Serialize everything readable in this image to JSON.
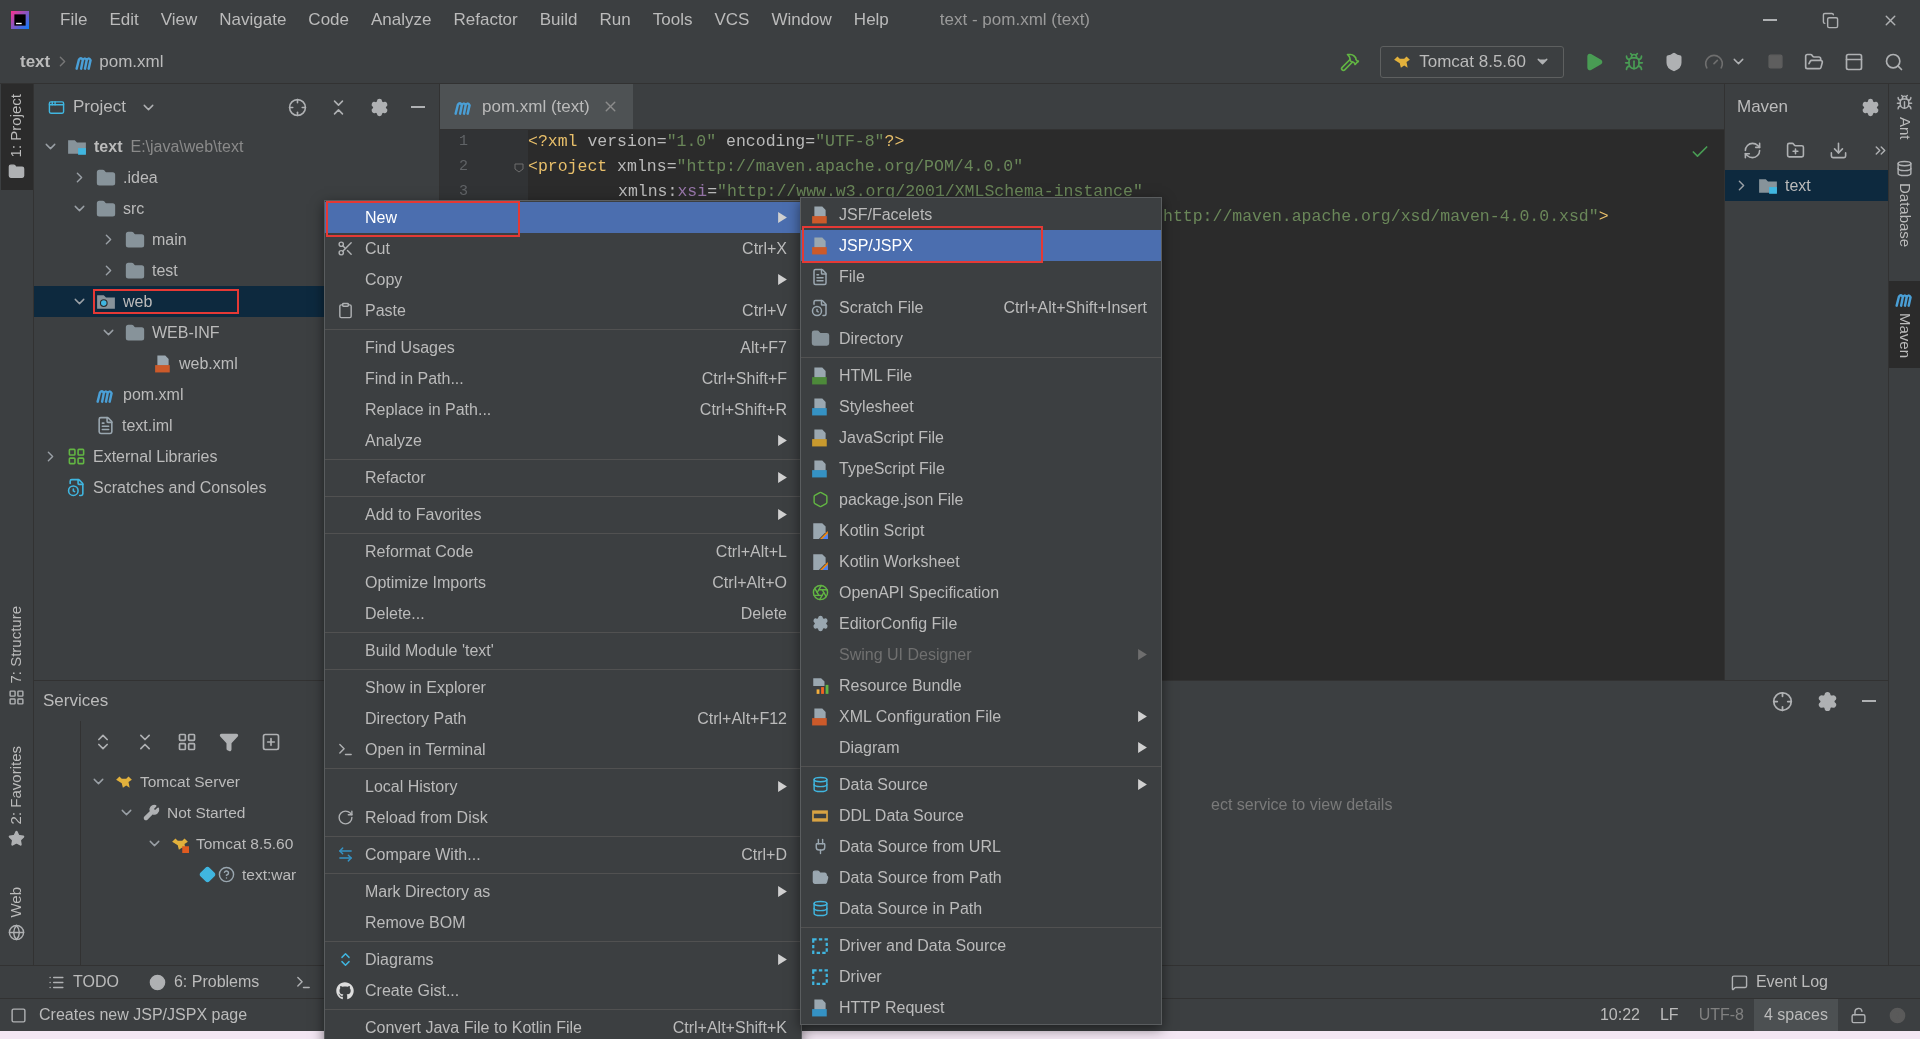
{
  "title_bar": {
    "menus": [
      "File",
      "Edit",
      "View",
      "Navigate",
      "Code",
      "Analyze",
      "Refactor",
      "Build",
      "Run",
      "Tools",
      "VCS",
      "Window",
      "Help"
    ],
    "title": "text - pom.xml (text)"
  },
  "nav_bar": {
    "breadcrumbs": [
      "text",
      "pom.xml"
    ],
    "run_config": "Tomcat 8.5.60"
  },
  "left_stripe": [
    {
      "label": "1: Project",
      "selected": true
    },
    {
      "label": "7: Structure",
      "selected": false
    },
    {
      "label": "2: Favorites",
      "selected": false
    },
    {
      "label": "Web",
      "selected": false
    }
  ],
  "right_stripe": [
    {
      "label": "Ant",
      "selected": false
    },
    {
      "label": "Database",
      "selected": false
    },
    {
      "label": "Maven",
      "selected": true
    }
  ],
  "project": {
    "title": "Project",
    "tree": [
      {
        "label": "text",
        "detail": "E:\\java\\web\\text",
        "kind": "module",
        "expanded": true,
        "selected": false,
        "outlined": false,
        "children": [
          {
            "label": ".idea",
            "kind": "folder",
            "expanded": false,
            "selected": false,
            "outlined": false
          },
          {
            "label": "src",
            "kind": "folder",
            "expanded": true,
            "selected": false,
            "outlined": false,
            "children": [
              {
                "label": "main",
                "kind": "folder",
                "expanded": false,
                "selected": false,
                "outlined": false
              },
              {
                "label": "test",
                "kind": "folder",
                "expanded": false,
                "selected": false,
                "outlined": false
              }
            ]
          },
          {
            "label": "web",
            "kind": "web",
            "expanded": true,
            "selected": true,
            "outlined": true,
            "children": [
              {
                "label": "WEB-INF",
                "kind": "folder",
                "expanded": true,
                "selected": false,
                "outlined": false,
                "children": [
                  {
                    "label": "web.xml",
                    "kind": "xml",
                    "selected": false,
                    "outlined": false
                  }
                ]
              }
            ]
          },
          {
            "label": "pom.xml",
            "kind": "maven",
            "selected": false,
            "outlined": false
          },
          {
            "label": "text.iml",
            "kind": "iml",
            "selected": false,
            "outlined": false
          }
        ]
      },
      {
        "label": "External Libraries",
        "kind": "libraries",
        "expanded": false,
        "selected": false,
        "outlined": false
      },
      {
        "label": "Scratches and Consoles",
        "kind": "scratches",
        "selected": false,
        "outlined": false
      }
    ]
  },
  "editor": {
    "tab": {
      "label": "pom.xml (text)",
      "selected": true
    },
    "lines": [
      {
        "number": "1",
        "kind": "code",
        "tokens": [
          {
            "text": "<?xml",
            "kind": "tag"
          },
          {
            "text": " version",
            "kind": "attr"
          },
          {
            "text": "=",
            "kind": "attr"
          },
          {
            "text": "\"1.0\"",
            "kind": "value"
          },
          {
            "text": " encoding",
            "kind": "attr"
          },
          {
            "text": "=",
            "kind": "attr"
          },
          {
            "text": "\"UTF-8\"",
            "kind": "value"
          },
          {
            "text": "?>",
            "kind": "tag"
          }
        ]
      },
      {
        "number": "2",
        "kind": "code",
        "tokens": [
          {
            "text": "<project",
            "kind": "tag"
          },
          {
            "text": " xmlns",
            "kind": "attr"
          },
          {
            "text": "=",
            "kind": "attr"
          },
          {
            "text": "\"http://maven.apache.org/POM/4.0.0\"",
            "kind": "value"
          }
        ]
      },
      {
        "number": "3",
        "kind": "continuation",
        "tokens": [
          {
            "text": "xmlns:",
            "kind": "attr"
          },
          {
            "text": "xsi",
            "kind": "ns"
          },
          {
            "text": "=",
            "kind": "attr"
          },
          {
            "text": "\"http://www.w3.org/2001/XMLSchema-instance\"",
            "kind": "value"
          }
        ]
      },
      {
        "kind": "partial",
        "tokens": [
          {
            "text": "http://maven.apache.org/xsd/maven-4.0.0.xsd\"",
            "kind": "value"
          },
          {
            "text": ">",
            "kind": "tag"
          }
        ]
      }
    ]
  },
  "maven": {
    "title": "Maven",
    "tree": [
      {
        "label": "text",
        "expanded": false,
        "selected": true
      }
    ]
  },
  "services": {
    "title": "Services",
    "tree": [
      {
        "label": "Tomcat Server",
        "kind": "server",
        "expanded": true,
        "children": [
          {
            "label": "Not Started",
            "kind": "status",
            "expanded": true,
            "children": [
              {
                "label": "Tomcat 8.5.60",
                "kind": "instance",
                "expanded": true,
                "children": [
                  {
                    "label": "text:war",
                    "kind": "artifact"
                  }
                ]
              }
            ]
          }
        ]
      }
    ],
    "hint": "ect service to view details"
  },
  "tool_strip": {
    "left": [
      "TODO",
      "6: Problems"
    ],
    "right": "Event Log"
  },
  "status_bar": {
    "message": "Creates new JSP/JSPX page",
    "items": [
      {
        "label": "10:22",
        "kind": "plain"
      },
      {
        "label": "LF",
        "kind": "plain"
      },
      {
        "label": "UTF-8",
        "kind": "dim"
      },
      {
        "label": "4 spaces",
        "kind": "boxed"
      }
    ]
  },
  "context_menu": {
    "groups": [
      [
        {
          "label": "New",
          "submenu": true,
          "selected": true,
          "outlined": true
        },
        {
          "label": "Cut",
          "shortcut": "Ctrl+X",
          "submenu": false,
          "selected": false,
          "outlined": false
        },
        {
          "label": "Copy",
          "submenu": true,
          "selected": false,
          "outlined": false
        },
        {
          "label": "Paste",
          "shortcut": "Ctrl+V",
          "submenu": false,
          "selected": false,
          "outlined": false
        }
      ],
      [
        {
          "label": "Find Usages",
          "shortcut": "Alt+F7",
          "submenu": false,
          "selected": false,
          "outlined": false
        },
        {
          "label": "Find in Path...",
          "shortcut": "Ctrl+Shift+F",
          "submenu": false,
          "selected": false,
          "outlined": false
        },
        {
          "label": "Replace in Path...",
          "shortcut": "Ctrl+Shift+R",
          "submenu": false,
          "selected": false,
          "outlined": false
        },
        {
          "label": "Analyze",
          "submenu": true,
          "selected": false,
          "outlined": false
        }
      ],
      [
        {
          "label": "Refactor",
          "submenu": true,
          "selected": false,
          "outlined": false
        }
      ],
      [
        {
          "label": "Add to Favorites",
          "submenu": true,
          "selected": false,
          "outlined": false
        }
      ],
      [
        {
          "label": "Reformat Code",
          "shortcut": "Ctrl+Alt+L",
          "submenu": false,
          "selected": false,
          "outlined": false
        },
        {
          "label": "Optimize Imports",
          "shortcut": "Ctrl+Alt+O",
          "submenu": false,
          "selected": false,
          "outlined": false
        },
        {
          "label": "Delete...",
          "shortcut": "Delete",
          "submenu": false,
          "selected": false,
          "outlined": false
        }
      ],
      [
        {
          "label": "Build Module 'text'",
          "submenu": false,
          "selected": false,
          "outlined": false
        }
      ],
      [
        {
          "label": "Show in Explorer",
          "submenu": false,
          "selected": false,
          "outlined": false
        },
        {
          "label": "Directory Path",
          "shortcut": "Ctrl+Alt+F12",
          "submenu": false,
          "selected": false,
          "outlined": false
        },
        {
          "label": "Open in Terminal",
          "submenu": false,
          "selected": false,
          "outlined": false
        }
      ],
      [
        {
          "label": "Local History",
          "submenu": true,
          "selected": false,
          "outlined": false
        },
        {
          "label": "Reload from Disk",
          "submenu": false,
          "selected": false,
          "outlined": false
        }
      ],
      [
        {
          "label": "Compare With...",
          "shortcut": "Ctrl+D",
          "submenu": false,
          "selected": false,
          "outlined": false
        }
      ],
      [
        {
          "label": "Mark Directory as",
          "submenu": true,
          "selected": false,
          "outlined": false
        },
        {
          "label": "Remove BOM",
          "submenu": false,
          "selected": false,
          "outlined": false
        }
      ],
      [
        {
          "label": "Diagrams",
          "submenu": true,
          "selected": false,
          "outlined": false
        },
        {
          "label": "Create Gist...",
          "submenu": false,
          "selected": false,
          "outlined": false
        }
      ],
      [
        {
          "label": "Convert Java File to Kotlin File",
          "shortcut": "Ctrl+Alt+Shift+K",
          "submenu": false,
          "selected": false,
          "outlined": false
        }
      ]
    ]
  },
  "submenu": {
    "groups": [
      [
        {
          "label": "JSF/Facelets",
          "submenu": false,
          "selected": false,
          "outlined": false,
          "disabled": false
        },
        {
          "label": "JSP/JSPX",
          "submenu": false,
          "selected": true,
          "outlined": true,
          "disabled": false
        },
        {
          "label": "File",
          "submenu": false,
          "selected": false,
          "outlined": false,
          "disabled": false
        },
        {
          "label": "Scratch File",
          "shortcut": "Ctrl+Alt+Shift+Insert",
          "submenu": false,
          "selected": false,
          "outlined": false,
          "disabled": false
        },
        {
          "label": "Directory",
          "submenu": false,
          "selected": false,
          "outlined": false,
          "disabled": false
        }
      ],
      [
        {
          "label": "HTML File",
          "submenu": false,
          "selected": false,
          "outlined": false,
          "disabled": false
        },
        {
          "label": "Stylesheet",
          "submenu": false,
          "selected": false,
          "outlined": false,
          "disabled": false
        },
        {
          "label": "JavaScript File",
          "submenu": false,
          "selected": false,
          "outlined": false,
          "disabled": false
        },
        {
          "label": "TypeScript File",
          "submenu": false,
          "selected": false,
          "outlined": false,
          "disabled": false
        },
        {
          "label": "package.json File",
          "submenu": false,
          "selected": false,
          "outlined": false,
          "disabled": false
        },
        {
          "label": "Kotlin Script",
          "submenu": false,
          "selected": false,
          "outlined": false,
          "disabled": false
        },
        {
          "label": "Kotlin Worksheet",
          "submenu": false,
          "selected": false,
          "outlined": false,
          "disabled": false
        },
        {
          "label": "OpenAPI Specification",
          "submenu": false,
          "selected": false,
          "outlined": false,
          "disabled": false
        },
        {
          "label": "EditorConfig File",
          "submenu": false,
          "selected": false,
          "outlined": false,
          "disabled": false
        },
        {
          "label": "Swing UI Designer",
          "submenu": true,
          "selected": false,
          "outlined": false,
          "disabled": true
        },
        {
          "label": "Resource Bundle",
          "submenu": false,
          "selected": false,
          "outlined": false,
          "disabled": false
        },
        {
          "label": "XML Configuration File",
          "submenu": true,
          "selected": false,
          "outlined": false,
          "disabled": false
        },
        {
          "label": "Diagram",
          "submenu": true,
          "selected": false,
          "outlined": false,
          "disabled": false
        }
      ],
      [
        {
          "label": "Data Source",
          "submenu": true,
          "selected": false,
          "outlined": false,
          "disabled": false
        },
        {
          "label": "DDL Data Source",
          "submenu": false,
          "selected": false,
          "outlined": false,
          "disabled": false
        },
        {
          "label": "Data Source from URL",
          "submenu": false,
          "selected": false,
          "outlined": false,
          "disabled": false
        },
        {
          "label": "Data Source from Path",
          "submenu": false,
          "selected": false,
          "outlined": false,
          "disabled": false
        },
        {
          "label": "Data Source in Path",
          "submenu": false,
          "selected": false,
          "outlined": false,
          "disabled": false
        }
      ],
      [
        {
          "label": "Driver and Data Source",
          "submenu": false,
          "selected": false,
          "outlined": false,
          "disabled": false
        },
        {
          "label": "Driver",
          "submenu": false,
          "selected": false,
          "outlined": false,
          "disabled": false
        },
        {
          "label": "HTTP Request",
          "submenu": false,
          "selected": false,
          "outlined": false,
          "disabled": false
        }
      ]
    ]
  }
}
